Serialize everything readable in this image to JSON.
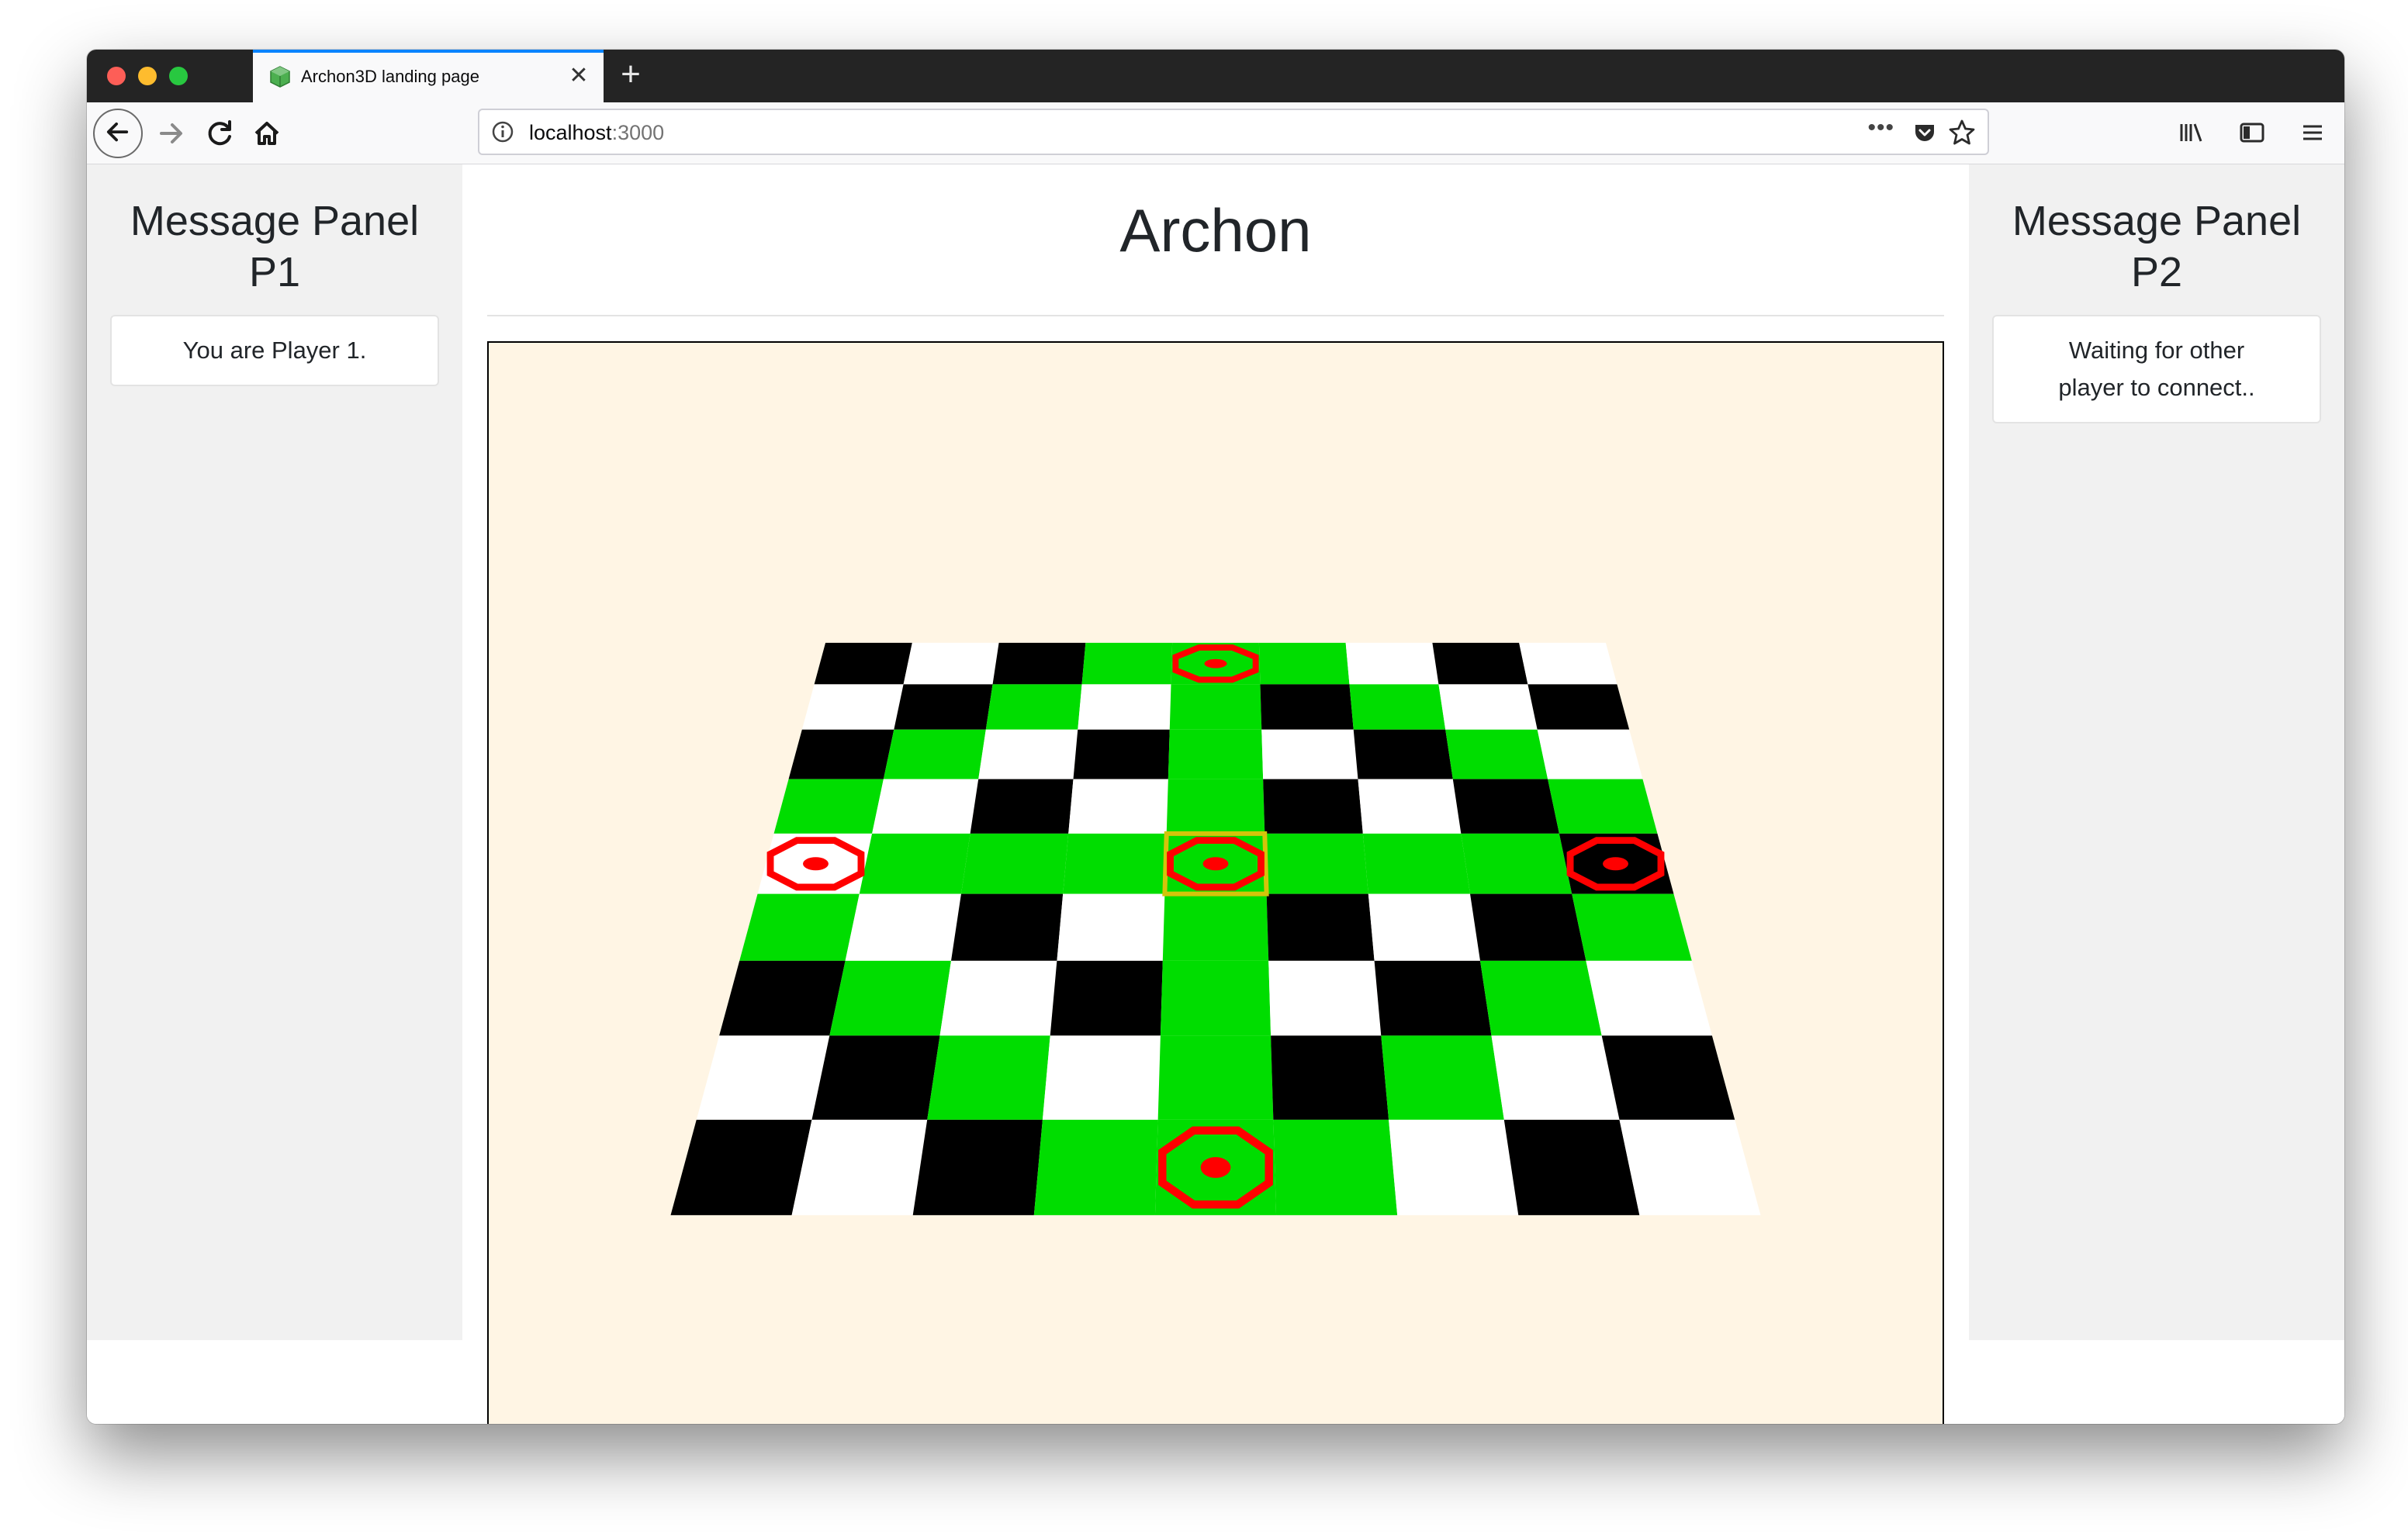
{
  "browser": {
    "tab_title": "Archon3D landing page",
    "url_host": "localhost",
    "url_port": ":3000"
  },
  "page": {
    "title": "Archon",
    "p1_panel": {
      "title_line1": "Message Panel",
      "title_line2": "P1",
      "message": "You are Player 1."
    },
    "p2_panel": {
      "title_line1": "Message Panel",
      "title_line2": "P2",
      "message_line1": "Waiting for other",
      "message_line2": "player to connect.."
    }
  },
  "board": {
    "rows": 9,
    "cols": 9,
    "colors": {
      "black": "#000000",
      "white": "#ffffff",
      "green": "#00dd00",
      "power": "#ff0000",
      "highlight": "#d4c40a",
      "background": "#fff5e4"
    },
    "cells": [
      [
        "B",
        "W",
        "B",
        "G",
        "G",
        "G",
        "W",
        "B",
        "W"
      ],
      [
        "W",
        "B",
        "G",
        "W",
        "G",
        "B",
        "G",
        "W",
        "B"
      ],
      [
        "B",
        "G",
        "W",
        "B",
        "G",
        "W",
        "B",
        "G",
        "W"
      ],
      [
        "G",
        "W",
        "B",
        "W",
        "G",
        "B",
        "W",
        "B",
        "G"
      ],
      [
        "W",
        "G",
        "G",
        "G",
        "G",
        "G",
        "G",
        "G",
        "B"
      ],
      [
        "G",
        "W",
        "B",
        "W",
        "G",
        "B",
        "W",
        "B",
        "G"
      ],
      [
        "B",
        "G",
        "W",
        "B",
        "G",
        "W",
        "B",
        "G",
        "W"
      ],
      [
        "W",
        "B",
        "G",
        "W",
        "G",
        "B",
        "G",
        "W",
        "B"
      ],
      [
        "B",
        "W",
        "B",
        "G",
        "G",
        "G",
        "W",
        "B",
        "W"
      ]
    ],
    "power_points": [
      {
        "row": 0,
        "col": 4
      },
      {
        "row": 4,
        "col": 0
      },
      {
        "row": 4,
        "col": 4
      },
      {
        "row": 4,
        "col": 8
      },
      {
        "row": 8,
        "col": 4
      }
    ],
    "highlighted_cell": {
      "row": 4,
      "col": 4
    }
  }
}
